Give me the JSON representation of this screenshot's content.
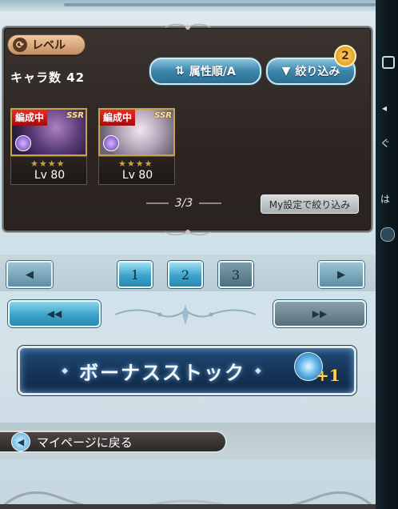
{
  "panel": {
    "level_label": "レベル",
    "char_count_label": "キャラ数 42",
    "sort_label": "属性順/A",
    "filter_label": "絞り込み",
    "filter_badge": "2",
    "page_indicator": "3/3",
    "my_setting_label": "My設定で絞り込み"
  },
  "cards": [
    {
      "tag": "編成中",
      "rarity": "SSR",
      "stars": "★★★★",
      "level": "Lv 80"
    },
    {
      "tag": "編成中",
      "rarity": "SSR",
      "stars": "★★★★",
      "level": "Lv 80"
    }
  ],
  "pager": {
    "prev_icon": "◀",
    "next_icon": "▶",
    "pages": [
      "1",
      "2",
      "3"
    ],
    "first_icon": "◀◀",
    "last_icon": "▶▶"
  },
  "bonus": {
    "label": "ボーナスストック",
    "count": "+1"
  },
  "nav": {
    "mypage_label": "マイページに戻る"
  },
  "right_strip": {
    "text1": "ぐ",
    "text2": "は"
  },
  "colors": {
    "accent_blue": "#3aa4cc",
    "panel_bg": "#2c2522",
    "tag_red": "#d21f1f",
    "gold": "#c9a24a"
  }
}
